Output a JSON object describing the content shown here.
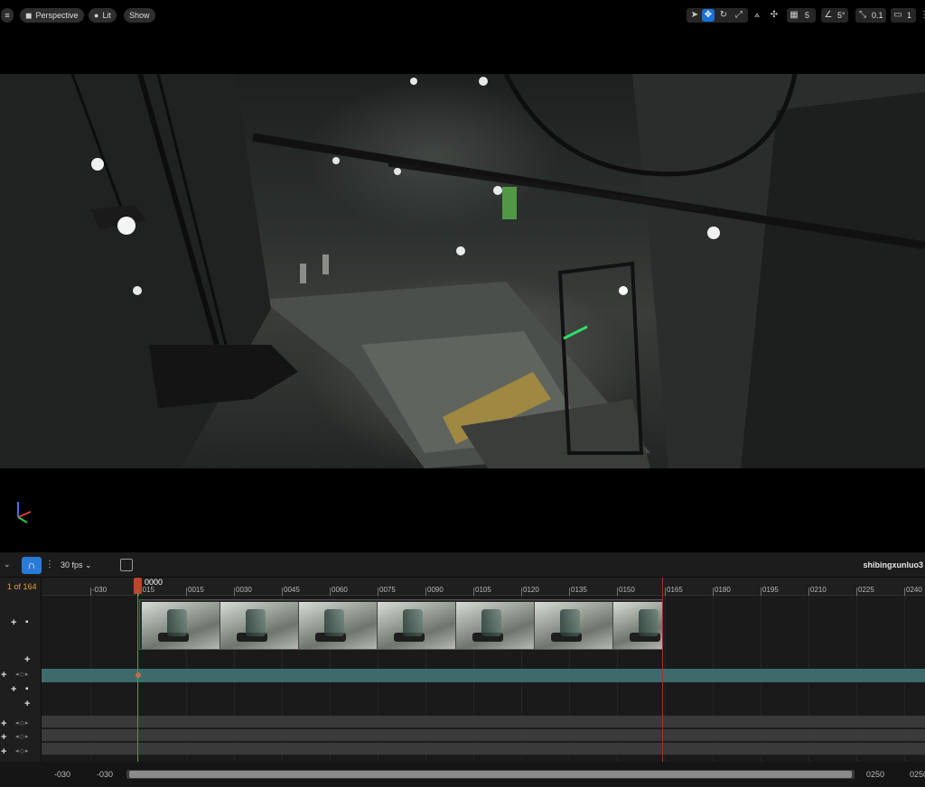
{
  "viewport": {
    "toolbar": {
      "menu_icon": "hamburger-icon",
      "perspective_label": "Perspective",
      "lit_label": "Lit",
      "show_label": "Show",
      "grid_snap_value": "5",
      "rotation_snap_value": "5°",
      "scale_snap_value": "0.1",
      "camera_speed_value": "1"
    }
  },
  "sequencer": {
    "fps_label": "30 fps",
    "sequence_name": "shibingxunluo3",
    "frame_counter": "1 of 164",
    "playhead_label": "0000",
    "ruler_ticks": [
      "-030",
      "-015",
      "0015",
      "0030",
      "0045",
      "0060",
      "0075",
      "0090",
      "0105",
      "0120",
      "0135",
      "0150",
      "0165",
      "0180",
      "0195",
      "0210",
      "0225",
      "0240"
    ],
    "view_range_start": "-030",
    "working_range_start": "-030",
    "view_range_end": "0250",
    "working_range_end": "0250"
  },
  "colors": {
    "accent": "#2a7bd8",
    "playhead": "#c0442a",
    "playhead_line": "#2aa84c",
    "end_marker": "#a8302a",
    "teal_track": "#3d6b6b",
    "frame_counter": "#e0a030"
  }
}
